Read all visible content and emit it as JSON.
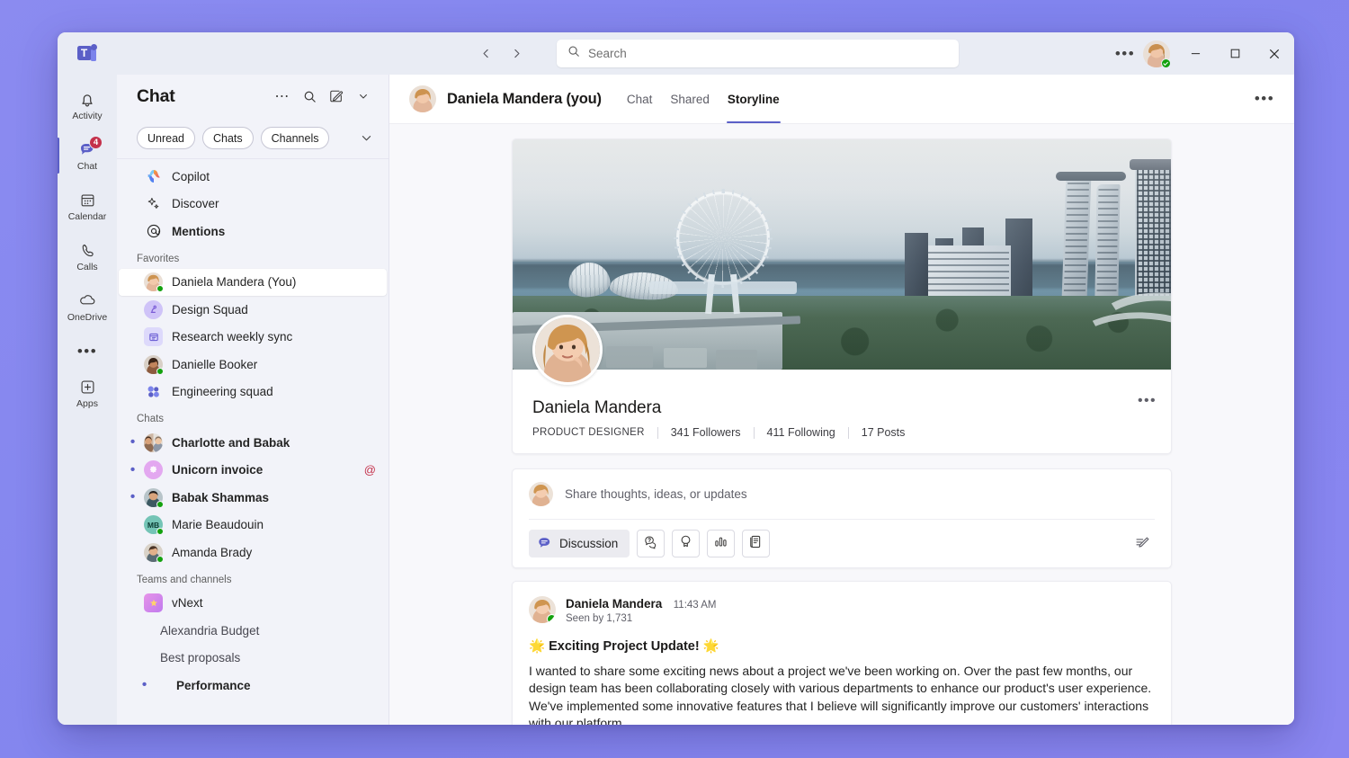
{
  "titlebar": {
    "logo_name": "Microsoft Teams",
    "back_icon": "chevron-left-icon",
    "forward_icon": "chevron-right-icon",
    "search_placeholder": "Search",
    "search_value": "",
    "search_icon": "search-icon",
    "more_label": "•••",
    "minimize_label": "─",
    "maximize_label": "□",
    "close_label": "✕"
  },
  "rail": {
    "items": [
      {
        "label": "Activity",
        "icon": "bell-icon",
        "badge": "",
        "active": false
      },
      {
        "label": "Chat",
        "icon": "chat-bubble-icon",
        "badge": "4",
        "active": true
      },
      {
        "label": "Calendar",
        "icon": "calendar-icon",
        "badge": "",
        "active": false
      },
      {
        "label": "Calls",
        "icon": "phone-icon",
        "badge": "",
        "active": false
      },
      {
        "label": "OneDrive",
        "icon": "cloud-icon",
        "badge": "",
        "active": false
      }
    ],
    "more_label": "•••",
    "apps": {
      "label": "Apps",
      "icon": "apps-plus-icon"
    }
  },
  "chatlist": {
    "title": "Chat",
    "header_icons": [
      "more-icon",
      "search-icon",
      "compose-icon",
      "chevron-down-icon"
    ],
    "filters": [
      "Unread",
      "Chats",
      "Channels"
    ],
    "filter_expand_icon": "chevron-down-icon",
    "top_items": [
      {
        "label": "Copilot",
        "icon": "copilot-icon",
        "bold": false
      },
      {
        "label": "Discover",
        "icon": "sparkle-icon",
        "bold": false
      },
      {
        "label": "Mentions",
        "icon": "at-mention-icon",
        "bold": true
      }
    ],
    "sections": [
      {
        "label": "Favorites",
        "items": [
          {
            "label": "Daniela Mandera (You)",
            "kind": "photo",
            "tone": "daniela",
            "presence": true,
            "selected": true,
            "unread": false,
            "bullet": false
          },
          {
            "label": "Design Squad",
            "kind": "group-avatar",
            "color": "#c8b5f5",
            "presence": false,
            "selected": false,
            "unread": false,
            "bullet": false
          },
          {
            "label": "Research weekly sync",
            "kind": "channel-icon",
            "color": "#c6c2f7",
            "presence": false,
            "selected": false,
            "unread": false,
            "bullet": false
          },
          {
            "label": "Danielle Booker",
            "kind": "photo",
            "tone": "danielle",
            "presence": true,
            "selected": false,
            "unread": false,
            "bullet": false
          },
          {
            "label": "Engineering squad",
            "kind": "people-icon",
            "color": "#7b83eb",
            "presence": false,
            "selected": false,
            "unread": false,
            "bullet": false
          }
        ]
      },
      {
        "label": "Chats",
        "items": [
          {
            "label": "Charlotte and Babak",
            "kind": "duo-photo",
            "tone": "duo",
            "presence": false,
            "selected": false,
            "unread": true,
            "bullet": true
          },
          {
            "label": "Unicorn invoice",
            "kind": "group-avatar",
            "color": "#d69ae8",
            "presence": false,
            "selected": false,
            "unread": true,
            "bullet": true,
            "mention": "@"
          },
          {
            "label": "Babak Shammas",
            "kind": "photo",
            "tone": "babak",
            "presence": true,
            "selected": false,
            "unread": true,
            "bullet": true
          },
          {
            "label": "Marie Beaudouin",
            "kind": "initials",
            "initials": "MB",
            "color": "#74c4b6",
            "presence": true,
            "selected": false,
            "unread": false,
            "bullet": false
          },
          {
            "label": "Amanda Brady",
            "kind": "photo",
            "tone": "amanda",
            "presence": true,
            "selected": false,
            "unread": false,
            "bullet": false
          }
        ]
      },
      {
        "label": "Teams and channels",
        "items": [
          {
            "label": "vNext",
            "kind": "team-icon",
            "color": "#e07ad6",
            "presence": false,
            "selected": false,
            "unread": false,
            "bullet": false
          },
          {
            "label": "Alexandria Budget",
            "kind": "channel",
            "presence": false,
            "selected": false,
            "unread": false,
            "bullet": false
          },
          {
            "label": "Best proposals",
            "kind": "channel",
            "presence": false,
            "selected": false,
            "unread": false,
            "bullet": false
          },
          {
            "label": "Performance",
            "kind": "channel",
            "presence": false,
            "selected": false,
            "unread": true,
            "bullet": true
          }
        ]
      }
    ]
  },
  "main": {
    "header": {
      "avatar_name": "daniela-avatar",
      "title": "Daniela Mandera (you)",
      "tabs": [
        {
          "label": "Chat",
          "active": false
        },
        {
          "label": "Shared",
          "active": false
        },
        {
          "label": "Storyline",
          "active": true
        }
      ],
      "more_label": "•••"
    },
    "profile": {
      "cover_image_name": "singapore-marina-bay-cover-photo",
      "avatar_name": "daniela-profile-photo",
      "name": "Daniela Mandera",
      "role": "PRODUCT DESIGNER",
      "followers": "341 Followers",
      "following": "411 Following",
      "posts": "17 Posts",
      "more_label": "•••"
    },
    "composer": {
      "avatar_name": "daniela-avatar-small",
      "placeholder": "Share thoughts, ideas, or updates",
      "value": "",
      "primary_chip": {
        "label": "Discussion",
        "icon": "discussion-bubble-icon"
      },
      "buttons": [
        {
          "name": "qna-button",
          "icon": "qna-icon"
        },
        {
          "name": "praise-button",
          "icon": "praise-award-icon"
        },
        {
          "name": "poll-button",
          "icon": "poll-bars-icon"
        },
        {
          "name": "article-button",
          "icon": "article-document-icon"
        }
      ],
      "edit_icon": "compose-edit-icon"
    },
    "post": {
      "author": "Daniela Mandera",
      "time": "11:43 AM",
      "seen": "Seen by 1,731",
      "title": "🌟 Exciting Project Update! 🌟",
      "body": "I wanted to share some exciting news about a project we've been working on. Over the past few months, our design team has been collaborating closely with various departments to enhance our product's user experience. We've implemented some innovative features that I believe will significantly improve our customers' interactions with our platform."
    }
  },
  "colors": {
    "brand": "#5b5fc7",
    "accent": "#7b83eb",
    "badge": "#c4314b",
    "presence_online": "#13a10e",
    "desktop_bg": "#8184ee"
  }
}
